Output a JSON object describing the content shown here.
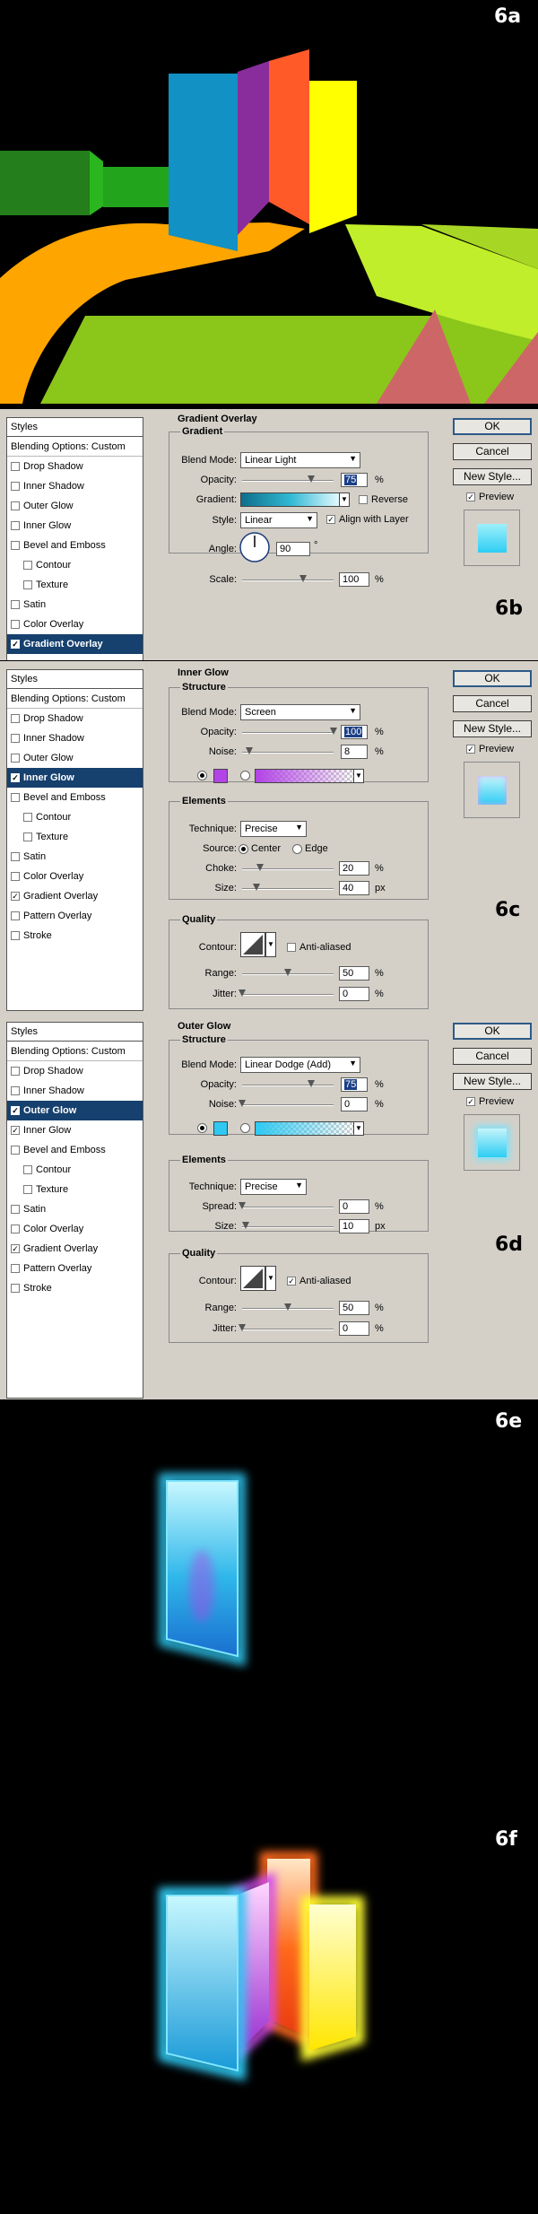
{
  "panels": {
    "p6a": {
      "label": "6a"
    },
    "p6e": {
      "label": "6e"
    },
    "p6f": {
      "label": "6f"
    }
  },
  "colors": {
    "green_dark": "#237e1b",
    "green_mid": "#22a51d",
    "orange": "#ffa500",
    "lime": "#8bc61a",
    "blue": "#1191c4",
    "purple": "#8a2d9c",
    "red_orange": "#ff5a28",
    "yellow": "#ffff00",
    "yellow_green": "#c0ee2a",
    "rose": "#cd6767",
    "dialog_bg": "#d4d0c8",
    "selection": "#16406e"
  },
  "dialogs": {
    "d6b": {
      "label": "6b",
      "styles": {
        "header": "Styles",
        "blending": "Blending Options: Custom",
        "items": [
          {
            "label": "Drop Shadow",
            "checked": false
          },
          {
            "label": "Inner Shadow",
            "checked": false
          },
          {
            "label": "Outer Glow",
            "checked": false
          },
          {
            "label": "Inner Glow",
            "checked": false
          },
          {
            "label": "Bevel and Emboss",
            "checked": false
          },
          {
            "label": "Contour",
            "checked": false,
            "indent": true
          },
          {
            "label": "Texture",
            "checked": false,
            "indent": true
          },
          {
            "label": "Satin",
            "checked": false
          },
          {
            "label": "Color Overlay",
            "checked": false
          },
          {
            "label": "Gradient Overlay",
            "checked": true,
            "selected": true
          }
        ]
      },
      "buttons": {
        "ok": "OK",
        "cancel": "Cancel",
        "new_style": "New Style...",
        "preview": "Preview"
      },
      "title": "Gradient Overlay",
      "group": "Gradient",
      "blend_mode_label": "Blend Mode:",
      "blend_mode": "Linear Light",
      "opacity_label": "Opacity:",
      "opacity": "75",
      "opacity_pct": 75,
      "gradient_label": "Gradient:",
      "reverse": "Reverse",
      "style_label": "Style:",
      "style": "Linear",
      "align": "Align with Layer",
      "angle_label": "Angle:",
      "angle": "90",
      "angle_unit": "°",
      "scale_label": "Scale:",
      "scale": "100",
      "scale_pct": 100,
      "pct": "%"
    },
    "d6c": {
      "label": "6c",
      "styles": {
        "header": "Styles",
        "blending": "Blending Options: Custom",
        "items": [
          {
            "label": "Drop Shadow",
            "checked": false
          },
          {
            "label": "Inner Shadow",
            "checked": false
          },
          {
            "label": "Outer Glow",
            "checked": false
          },
          {
            "label": "Inner Glow",
            "checked": true,
            "selected": true
          },
          {
            "label": "Bevel and Emboss",
            "checked": false
          },
          {
            "label": "Contour",
            "checked": false,
            "indent": true
          },
          {
            "label": "Texture",
            "checked": false,
            "indent": true
          },
          {
            "label": "Satin",
            "checked": false
          },
          {
            "label": "Color Overlay",
            "checked": false
          },
          {
            "label": "Gradient Overlay",
            "checked": true
          },
          {
            "label": "Pattern Overlay",
            "checked": false
          },
          {
            "label": "Stroke",
            "checked": false
          }
        ]
      },
      "buttons": {
        "ok": "OK",
        "cancel": "Cancel",
        "new_style": "New Style...",
        "preview": "Preview"
      },
      "title": "Inner Glow",
      "structure": "Structure",
      "blend_mode_label": "Blend Mode:",
      "blend_mode": "Screen",
      "opacity_label": "Opacity:",
      "opacity": "100",
      "opacity_pct": 100,
      "noise_label": "Noise:",
      "noise": "8",
      "noise_pct": 8,
      "glow_color": "#b243e6",
      "elements": "Elements",
      "technique_label": "Technique:",
      "technique": "Precise",
      "source_label": "Source:",
      "source_center": "Center",
      "source_edge": "Edge",
      "choke_label": "Choke:",
      "choke": "20",
      "choke_pct": 20,
      "size_label": "Size:",
      "size": "40",
      "size_frac": 0.16,
      "quality": "Quality",
      "contour_label": "Contour:",
      "anti_aliased": "Anti-aliased",
      "anti_aliased_checked": false,
      "range_label": "Range:",
      "range": "50",
      "range_pct": 50,
      "jitter_label": "Jitter:",
      "jitter": "0",
      "jitter_pct": 0,
      "pct": "%",
      "px": "px"
    },
    "d6d": {
      "label": "6d",
      "styles": {
        "header": "Styles",
        "blending": "Blending Options: Custom",
        "items": [
          {
            "label": "Drop Shadow",
            "checked": false
          },
          {
            "label": "Inner Shadow",
            "checked": false
          },
          {
            "label": "Outer Glow",
            "checked": true,
            "selected": true
          },
          {
            "label": "Inner Glow",
            "checked": true
          },
          {
            "label": "Bevel and Emboss",
            "checked": false
          },
          {
            "label": "Contour",
            "checked": false,
            "indent": true
          },
          {
            "label": "Texture",
            "checked": false,
            "indent": true
          },
          {
            "label": "Satin",
            "checked": false
          },
          {
            "label": "Color Overlay",
            "checked": false
          },
          {
            "label": "Gradient Overlay",
            "checked": true
          },
          {
            "label": "Pattern Overlay",
            "checked": false
          },
          {
            "label": "Stroke",
            "checked": false
          }
        ]
      },
      "buttons": {
        "ok": "OK",
        "cancel": "Cancel",
        "new_style": "New Style...",
        "preview": "Preview"
      },
      "title": "Outer Glow",
      "structure": "Structure",
      "blend_mode_label": "Blend Mode:",
      "blend_mode": "Linear Dodge (Add)",
      "opacity_label": "Opacity:",
      "opacity": "75",
      "opacity_pct": 75,
      "noise_label": "Noise:",
      "noise": "0",
      "noise_pct": 0,
      "glow_color": "#2ec8f2",
      "elements": "Elements",
      "technique_label": "Technique:",
      "technique": "Precise",
      "spread_label": "Spread:",
      "spread": "0",
      "spread_pct": 0,
      "size_label": "Size:",
      "size": "10",
      "size_frac": 0.04,
      "quality": "Quality",
      "contour_label": "Contour:",
      "anti_aliased": "Anti-aliased",
      "anti_aliased_checked": true,
      "range_label": "Range:",
      "range": "50",
      "range_pct": 50,
      "jitter_label": "Jitter:",
      "jitter": "0",
      "jitter_pct": 0,
      "pct": "%",
      "px": "px"
    }
  }
}
